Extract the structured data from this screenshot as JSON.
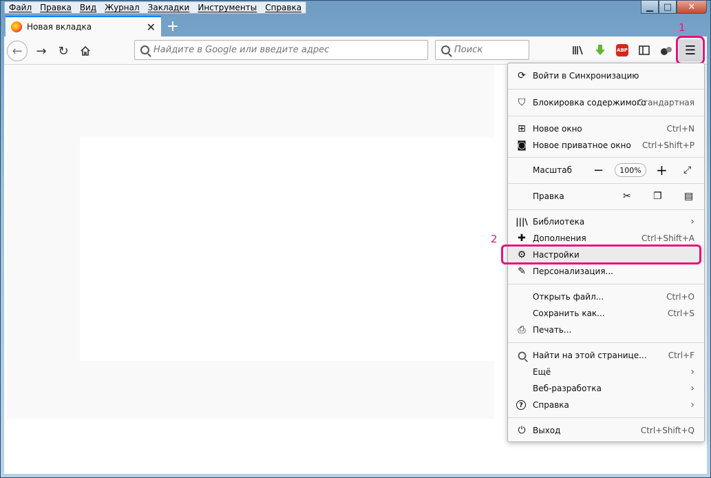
{
  "menubar": [
    "Файл",
    "Правка",
    "Вид",
    "Журнал",
    "Закладки",
    "Инструменты",
    "Справка"
  ],
  "window_controls": {
    "min": "▁",
    "max": "□",
    "close": "✕"
  },
  "tab": {
    "title": "Новая вкладка",
    "close": "✕",
    "new_tab": "+"
  },
  "navbar": {
    "url_placeholder": "Найдите в Google или введите адрес",
    "search_placeholder": "Поиск",
    "abp_label": "ABP"
  },
  "annotations": {
    "one": "1",
    "two": "2"
  },
  "menu": {
    "sync": "Войти в Синхронизацию",
    "blocking": "Блокировка содержимого",
    "blocking_value": "Стандартная",
    "new_window": "Новое окно",
    "new_window_sc": "Ctrl+N",
    "private_window": "Новое приватное окно",
    "private_window_sc": "Ctrl+Shift+P",
    "zoom": "Масштаб",
    "zoom_value": "100%",
    "edit": "Правка",
    "library": "Библиотека",
    "addons": "Дополнения",
    "addons_sc": "Ctrl+Shift+A",
    "settings": "Настройки",
    "customize": "Персонализация...",
    "open_file": "Открыть файл...",
    "open_file_sc": "Ctrl+O",
    "save_as": "Сохранить как...",
    "save_as_sc": "Ctrl+S",
    "print": "Печать...",
    "find": "Найти на этой странице...",
    "find_sc": "Ctrl+F",
    "more": "Ещё",
    "webdev": "Веб-разработка",
    "help": "Справка",
    "exit": "Выход",
    "exit_sc": "Ctrl+Shift+Q"
  },
  "colors": {
    "highlight": "#e5127d",
    "accent": "#0a84ff"
  }
}
